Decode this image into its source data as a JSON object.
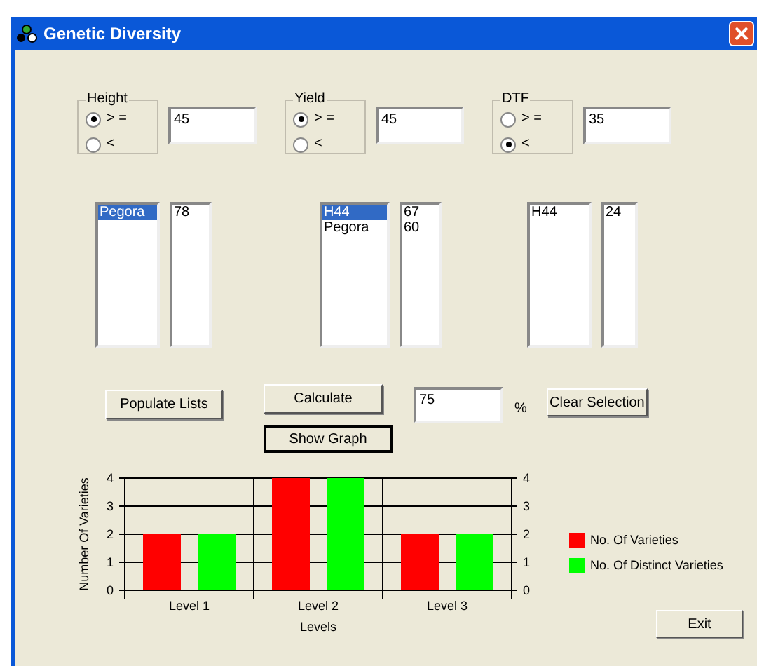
{
  "window": {
    "title": "Genetic Diversity"
  },
  "filters": [
    {
      "label": "Height",
      "options": [
        {
          "label": "> =",
          "selected": true
        },
        {
          "label": "<",
          "selected": false
        }
      ],
      "value": "45"
    },
    {
      "label": "Yield",
      "options": [
        {
          "label": "> =",
          "selected": true
        },
        {
          "label": "<",
          "selected": false
        }
      ],
      "value": "45"
    },
    {
      "label": "DTF",
      "options": [
        {
          "label": "> =",
          "selected": false
        },
        {
          "label": "<",
          "selected": true
        }
      ],
      "value": "35"
    }
  ],
  "lists": [
    {
      "names": [
        {
          "text": "Pegora",
          "selected": true
        }
      ],
      "values": [
        "78"
      ]
    },
    {
      "names": [
        {
          "text": "H44",
          "selected": true
        },
        {
          "text": "Pegora",
          "selected": false
        }
      ],
      "values": [
        "67",
        "60"
      ]
    },
    {
      "names": [
        {
          "text": "H44",
          "selected": false
        }
      ],
      "values": [
        "24"
      ]
    }
  ],
  "buttons": {
    "populate": "Populate Lists",
    "calculate": "Calculate",
    "show_graph": "Show Graph",
    "clear": "Clear Selection",
    "exit": "Exit"
  },
  "percent": {
    "value": "75",
    "unit": "%"
  },
  "chart_data": {
    "type": "bar",
    "xlabel": "Levels",
    "ylabel": "Number Of Varieties",
    "categories": [
      "Level 1",
      "Level 2",
      "Level 3"
    ],
    "series": [
      {
        "name": "No. Of Varieties",
        "color": "#ff0000",
        "values": [
          2,
          4,
          2
        ]
      },
      {
        "name": "No. Of Distinct Varieties",
        "color": "#00ff00",
        "values": [
          2,
          4,
          2
        ]
      }
    ],
    "ylim": [
      0,
      4
    ],
    "yticks": [
      0,
      1,
      2,
      3,
      4
    ],
    "y2ticks": [
      0,
      1,
      2,
      3,
      4
    ],
    "y2lim": [
      0,
      4
    ],
    "grid": true
  }
}
